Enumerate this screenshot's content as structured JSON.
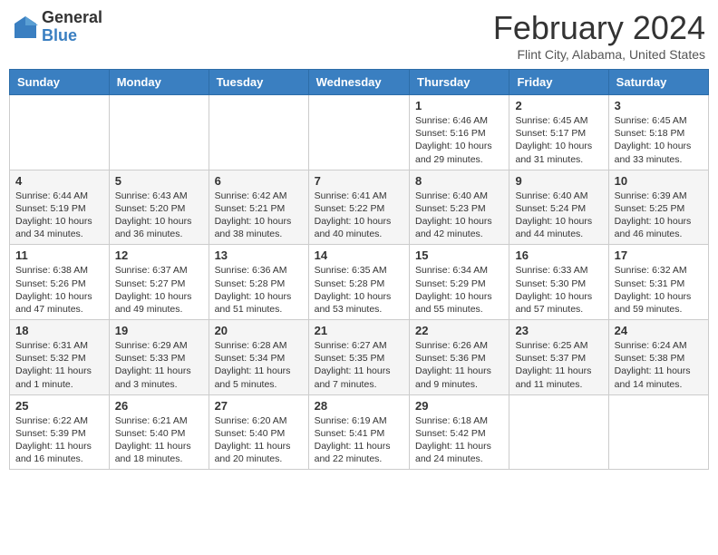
{
  "header": {
    "logo_general": "General",
    "logo_blue": "Blue",
    "title": "February 2024",
    "location": "Flint City, Alabama, United States"
  },
  "days_of_week": [
    "Sunday",
    "Monday",
    "Tuesday",
    "Wednesday",
    "Thursday",
    "Friday",
    "Saturday"
  ],
  "weeks": [
    [
      {
        "day": "",
        "info": ""
      },
      {
        "day": "",
        "info": ""
      },
      {
        "day": "",
        "info": ""
      },
      {
        "day": "",
        "info": ""
      },
      {
        "day": "1",
        "info": "Sunrise: 6:46 AM\nSunset: 5:16 PM\nDaylight: 10 hours\nand 29 minutes."
      },
      {
        "day": "2",
        "info": "Sunrise: 6:45 AM\nSunset: 5:17 PM\nDaylight: 10 hours\nand 31 minutes."
      },
      {
        "day": "3",
        "info": "Sunrise: 6:45 AM\nSunset: 5:18 PM\nDaylight: 10 hours\nand 33 minutes."
      }
    ],
    [
      {
        "day": "4",
        "info": "Sunrise: 6:44 AM\nSunset: 5:19 PM\nDaylight: 10 hours\nand 34 minutes."
      },
      {
        "day": "5",
        "info": "Sunrise: 6:43 AM\nSunset: 5:20 PM\nDaylight: 10 hours\nand 36 minutes."
      },
      {
        "day": "6",
        "info": "Sunrise: 6:42 AM\nSunset: 5:21 PM\nDaylight: 10 hours\nand 38 minutes."
      },
      {
        "day": "7",
        "info": "Sunrise: 6:41 AM\nSunset: 5:22 PM\nDaylight: 10 hours\nand 40 minutes."
      },
      {
        "day": "8",
        "info": "Sunrise: 6:40 AM\nSunset: 5:23 PM\nDaylight: 10 hours\nand 42 minutes."
      },
      {
        "day": "9",
        "info": "Sunrise: 6:40 AM\nSunset: 5:24 PM\nDaylight: 10 hours\nand 44 minutes."
      },
      {
        "day": "10",
        "info": "Sunrise: 6:39 AM\nSunset: 5:25 PM\nDaylight: 10 hours\nand 46 minutes."
      }
    ],
    [
      {
        "day": "11",
        "info": "Sunrise: 6:38 AM\nSunset: 5:26 PM\nDaylight: 10 hours\nand 47 minutes."
      },
      {
        "day": "12",
        "info": "Sunrise: 6:37 AM\nSunset: 5:27 PM\nDaylight: 10 hours\nand 49 minutes."
      },
      {
        "day": "13",
        "info": "Sunrise: 6:36 AM\nSunset: 5:28 PM\nDaylight: 10 hours\nand 51 minutes."
      },
      {
        "day": "14",
        "info": "Sunrise: 6:35 AM\nSunset: 5:28 PM\nDaylight: 10 hours\nand 53 minutes."
      },
      {
        "day": "15",
        "info": "Sunrise: 6:34 AM\nSunset: 5:29 PM\nDaylight: 10 hours\nand 55 minutes."
      },
      {
        "day": "16",
        "info": "Sunrise: 6:33 AM\nSunset: 5:30 PM\nDaylight: 10 hours\nand 57 minutes."
      },
      {
        "day": "17",
        "info": "Sunrise: 6:32 AM\nSunset: 5:31 PM\nDaylight: 10 hours\nand 59 minutes."
      }
    ],
    [
      {
        "day": "18",
        "info": "Sunrise: 6:31 AM\nSunset: 5:32 PM\nDaylight: 11 hours\nand 1 minute."
      },
      {
        "day": "19",
        "info": "Sunrise: 6:29 AM\nSunset: 5:33 PM\nDaylight: 11 hours\nand 3 minutes."
      },
      {
        "day": "20",
        "info": "Sunrise: 6:28 AM\nSunset: 5:34 PM\nDaylight: 11 hours\nand 5 minutes."
      },
      {
        "day": "21",
        "info": "Sunrise: 6:27 AM\nSunset: 5:35 PM\nDaylight: 11 hours\nand 7 minutes."
      },
      {
        "day": "22",
        "info": "Sunrise: 6:26 AM\nSunset: 5:36 PM\nDaylight: 11 hours\nand 9 minutes."
      },
      {
        "day": "23",
        "info": "Sunrise: 6:25 AM\nSunset: 5:37 PM\nDaylight: 11 hours\nand 11 minutes."
      },
      {
        "day": "24",
        "info": "Sunrise: 6:24 AM\nSunset: 5:38 PM\nDaylight: 11 hours\nand 14 minutes."
      }
    ],
    [
      {
        "day": "25",
        "info": "Sunrise: 6:22 AM\nSunset: 5:39 PM\nDaylight: 11 hours\nand 16 minutes."
      },
      {
        "day": "26",
        "info": "Sunrise: 6:21 AM\nSunset: 5:40 PM\nDaylight: 11 hours\nand 18 minutes."
      },
      {
        "day": "27",
        "info": "Sunrise: 6:20 AM\nSunset: 5:40 PM\nDaylight: 11 hours\nand 20 minutes."
      },
      {
        "day": "28",
        "info": "Sunrise: 6:19 AM\nSunset: 5:41 PM\nDaylight: 11 hours\nand 22 minutes."
      },
      {
        "day": "29",
        "info": "Sunrise: 6:18 AM\nSunset: 5:42 PM\nDaylight: 11 hours\nand 24 minutes."
      },
      {
        "day": "",
        "info": ""
      },
      {
        "day": "",
        "info": ""
      }
    ]
  ]
}
